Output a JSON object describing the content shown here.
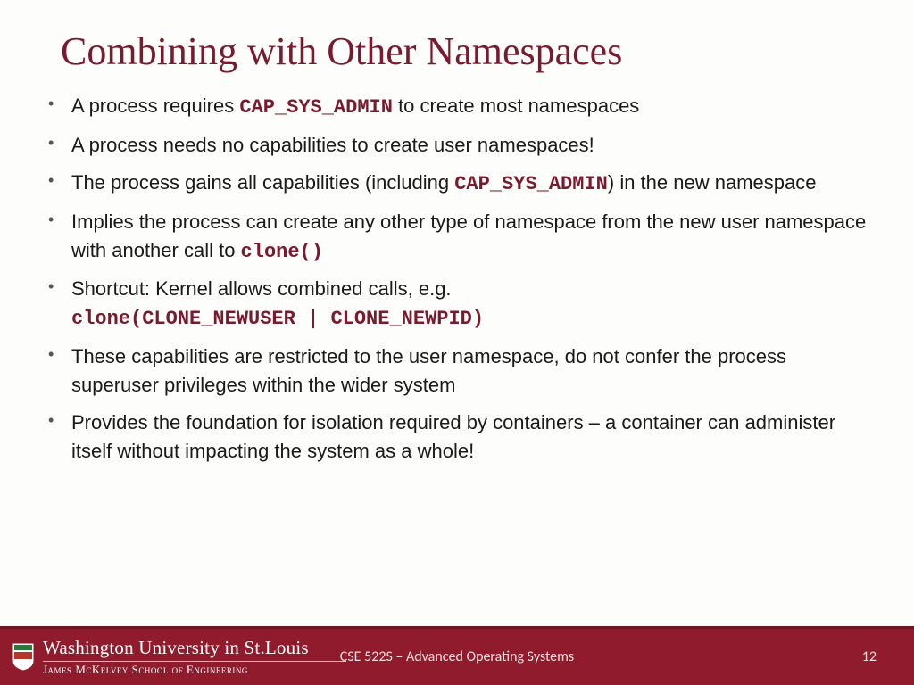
{
  "title": "Combining with Other Namespaces",
  "bullets": {
    "b0a": "A process requires ",
    "b0code": "CAP_SYS_ADMIN",
    "b0b": " to create most namespaces",
    "b1": "A process needs no capabilities to create user namespaces!",
    "b2a": "The process gains all capabilities (including ",
    "b2code": "CAP_SYS_ADMIN",
    "b2b": ") in the new namespace",
    "b3a": "Implies the process can create any other type of namespace from the new user namespace with another call to ",
    "b3code": "clone()",
    "b4a": "Shortcut: Kernel allows combined calls, e.g. ",
    "b4code": "clone(CLONE_NEWUSER | CLONE_NEWPID)",
    "b5": "These capabilities are restricted to the user namespace, do not confer the process superuser privileges within the wider system",
    "b6": "Provides the foundation for isolation required by containers – a container can administer itself without impacting the system as a whole!"
  },
  "footer": {
    "university": "Washington University in St.Louis",
    "school": "James McKelvey School of Engineering",
    "course": "CSE 522S – Advanced Operating Systems",
    "page": "12"
  }
}
